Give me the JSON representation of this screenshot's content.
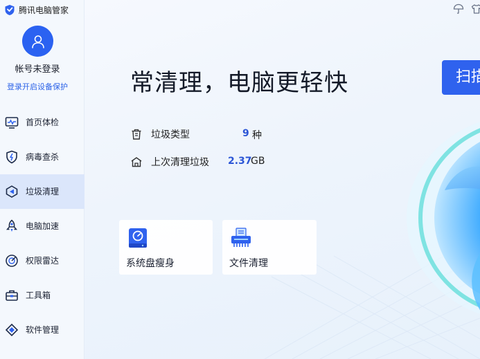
{
  "app": {
    "title": "腾讯电脑管家"
  },
  "account": {
    "name": "帐号未登录",
    "login_link": "登录开启设备保护"
  },
  "sidebar": {
    "items": [
      {
        "label": "首页体检",
        "icon": "monitor-checkup-icon",
        "active": false
      },
      {
        "label": "病毒查杀",
        "icon": "shield-virus-icon",
        "active": false
      },
      {
        "label": "垃圾清理",
        "icon": "broom-clean-icon",
        "active": true
      },
      {
        "label": "电脑加速",
        "icon": "rocket-speedup-icon",
        "active": false
      },
      {
        "label": "权限雷达",
        "icon": "radar-icon",
        "active": false
      },
      {
        "label": "工具箱",
        "icon": "toolbox-icon",
        "active": false
      },
      {
        "label": "软件管理",
        "icon": "software-manager-icon",
        "active": false
      }
    ]
  },
  "main": {
    "headline": "常清理，电脑更轻快",
    "stats": {
      "junk_types": {
        "label": "垃圾类型",
        "value": "9",
        "unit": "种"
      },
      "last_clean": {
        "label": "上次清理垃圾",
        "value": "2.37",
        "unit": "GB"
      }
    },
    "tools": [
      {
        "label": "系统盘瘦身",
        "icon": "disk-slim-icon"
      },
      {
        "label": "文件清理",
        "icon": "file-shredder-icon"
      }
    ],
    "scan_button": "扫描"
  },
  "colors": {
    "accent": "#2f62ee",
    "active_nav_bg": "#dbe6fb",
    "value_blue": "#2c56d6"
  }
}
